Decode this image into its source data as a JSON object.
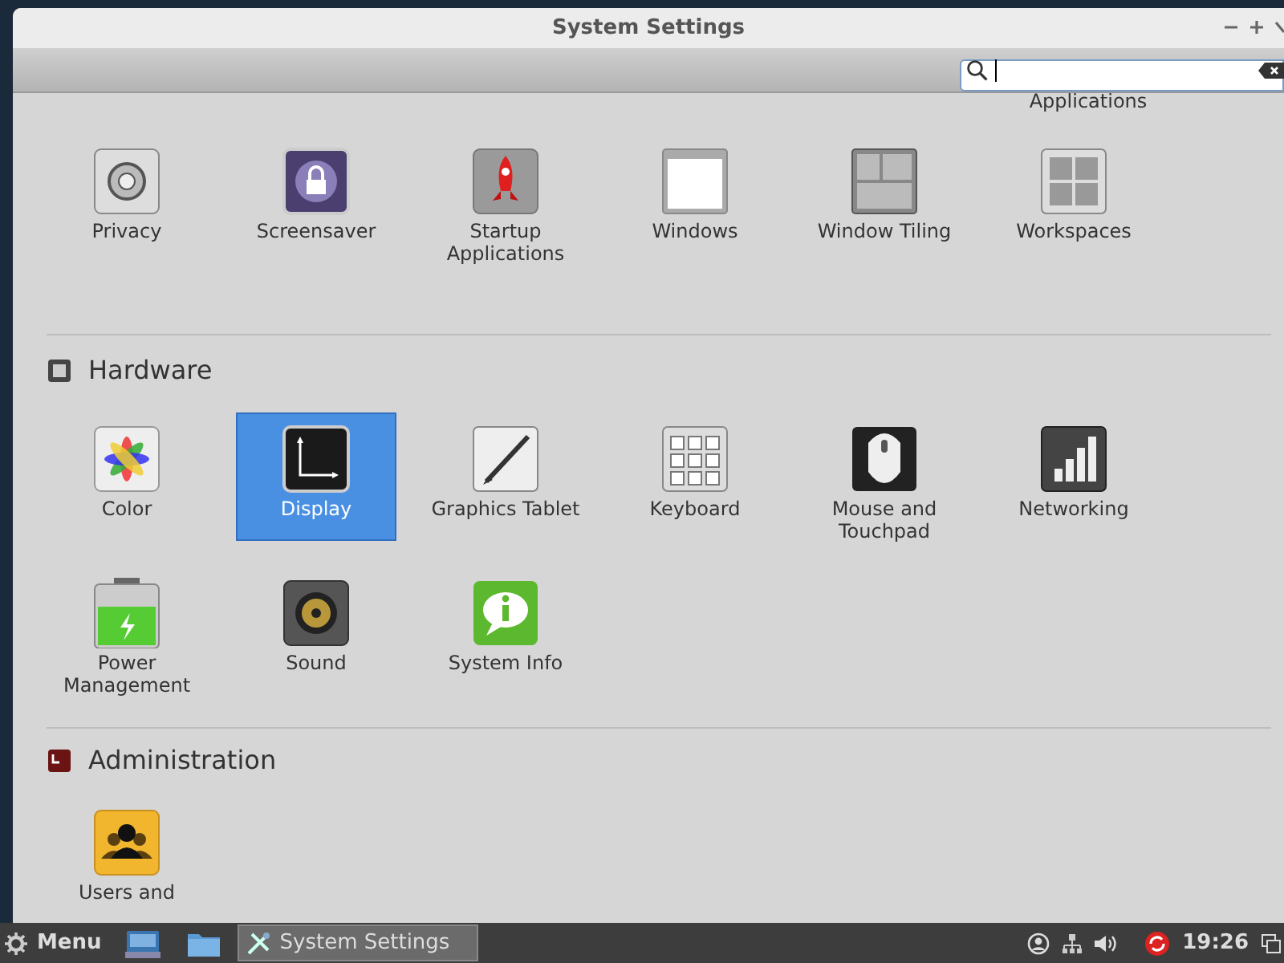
{
  "window": {
    "title": "System Settings"
  },
  "scrolled_labels": [
    "Applications"
  ],
  "sections": [
    {
      "items": [
        {
          "label": "Privacy",
          "kind": "privacy",
          "selected": false
        },
        {
          "label": "Screensaver",
          "kind": "lock",
          "selected": false
        },
        {
          "label": "Startup Applications",
          "kind": "rocket",
          "selected": false
        },
        {
          "label": "Windows",
          "kind": "window",
          "selected": false
        },
        {
          "label": "Window Tiling",
          "kind": "tiling",
          "selected": false
        },
        {
          "label": "Workspaces",
          "kind": "workspaces",
          "selected": false
        }
      ]
    },
    {
      "title": "Hardware",
      "kind": "hardware",
      "items": [
        {
          "label": "Color",
          "kind": "color",
          "selected": false
        },
        {
          "label": "Display",
          "kind": "display",
          "selected": true
        },
        {
          "label": "Graphics Tablet",
          "kind": "tablet",
          "selected": false
        },
        {
          "label": "Keyboard",
          "kind": "keyboard",
          "selected": false
        },
        {
          "label": "Mouse and Touchpad",
          "kind": "mouse",
          "selected": false
        },
        {
          "label": "Networking",
          "kind": "network",
          "selected": false
        },
        {
          "label": "Power Management",
          "kind": "battery",
          "selected": false
        },
        {
          "label": "Sound",
          "kind": "speaker",
          "selected": false
        },
        {
          "label": "System Info",
          "kind": "info",
          "selected": false
        }
      ]
    },
    {
      "title": "Administration",
      "kind": "admin",
      "items": [
        {
          "label": "Users and",
          "kind": "users",
          "selected": false
        }
      ]
    }
  ],
  "taskbar": {
    "menu": "Menu",
    "task": "System Settings",
    "clock": "19:26"
  }
}
